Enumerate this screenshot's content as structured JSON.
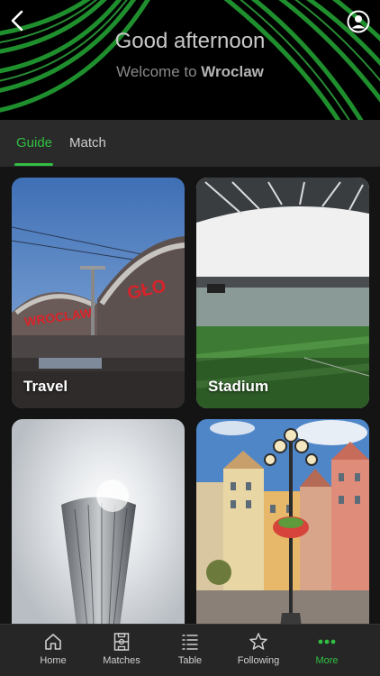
{
  "header": {
    "greeting": "Good afternoon",
    "welcome_prefix": "Welcome to",
    "city": "Wroclaw",
    "back_icon": "chevron-left-icon",
    "profile_icon": "user-circle-icon"
  },
  "tabs": [
    {
      "label": "Guide",
      "active": true
    },
    {
      "label": "Match",
      "active": false
    }
  ],
  "cards": [
    {
      "label": "Travel"
    },
    {
      "label": "Stadium"
    },
    {
      "label": ""
    },
    {
      "label": ""
    }
  ],
  "nav": [
    {
      "label": "Home",
      "icon": "home-icon",
      "active": false
    },
    {
      "label": "Matches",
      "icon": "pitch-icon",
      "active": false
    },
    {
      "label": "Table",
      "icon": "list-icon",
      "active": false
    },
    {
      "label": "Following",
      "icon": "star-icon",
      "active": false
    },
    {
      "label": "More",
      "icon": "more-dots-icon",
      "active": true
    }
  ],
  "colors": {
    "accent": "#31c042",
    "background": "#141414",
    "header": "#000000"
  }
}
